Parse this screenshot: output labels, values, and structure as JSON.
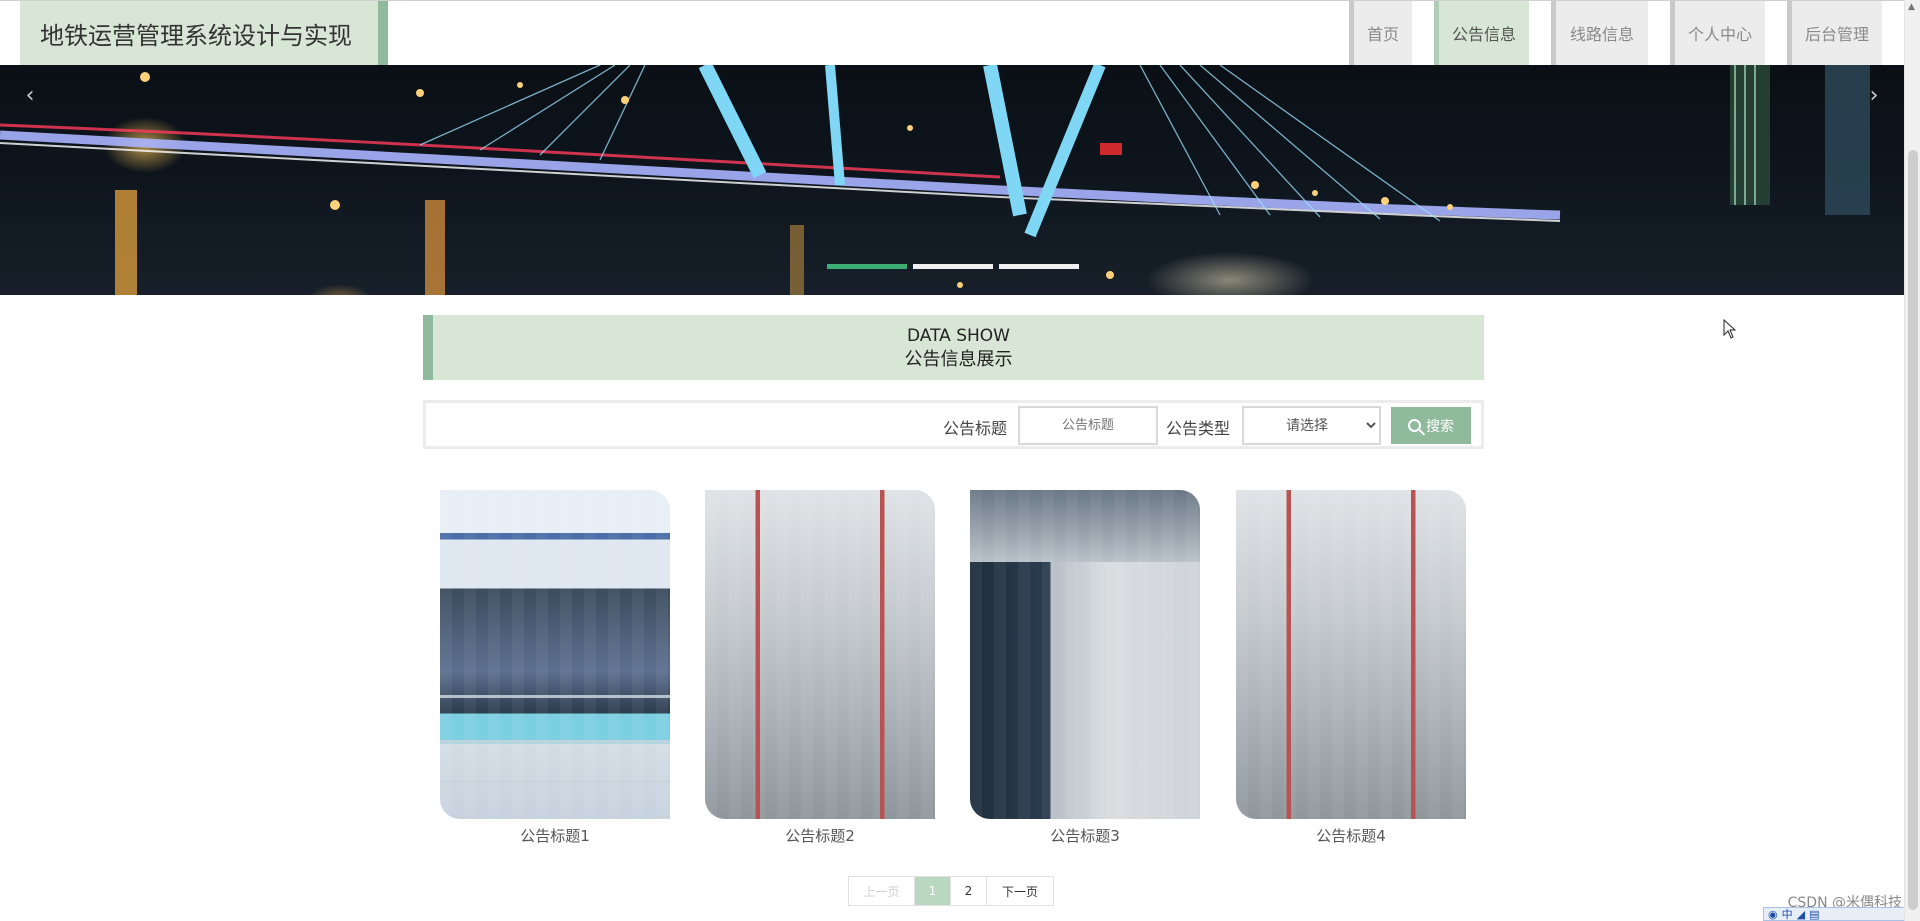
{
  "header": {
    "title": "地铁运营管理系统设计与实现",
    "nav": [
      {
        "label": "首页",
        "active": false
      },
      {
        "label": "公告信息",
        "active": true
      },
      {
        "label": "线路信息",
        "active": false
      },
      {
        "label": "个人中心",
        "active": false
      },
      {
        "label": "后台管理",
        "active": false
      }
    ]
  },
  "banner": {
    "prev_arrow": "‹",
    "next_arrow": "›",
    "slide_count": 3,
    "active_slide": 1
  },
  "section": {
    "title_en": "DATA SHOW",
    "title_cn": "公告信息展示"
  },
  "search": {
    "title_label": "公告标题",
    "title_placeholder": "公告标题",
    "type_label": "公告类型",
    "type_selected": "请选择",
    "button_label": "搜索"
  },
  "cards": [
    {
      "title": "公告标题1"
    },
    {
      "title": "公告标题2"
    },
    {
      "title": "公告标题3"
    },
    {
      "title": "公告标题4"
    }
  ],
  "pagination": {
    "prev_label": "上一页",
    "pages": [
      "1",
      "2"
    ],
    "current_page": "1",
    "next_label": "下一页"
  },
  "watermark": "CSDN @米偶科技",
  "tray": {
    "ime_label": "中"
  },
  "colors": {
    "accent": "#8fba9c",
    "accent_light": "#d8e6d6",
    "active_dot": "#3dae73",
    "page_active": "#b9d8bf"
  }
}
